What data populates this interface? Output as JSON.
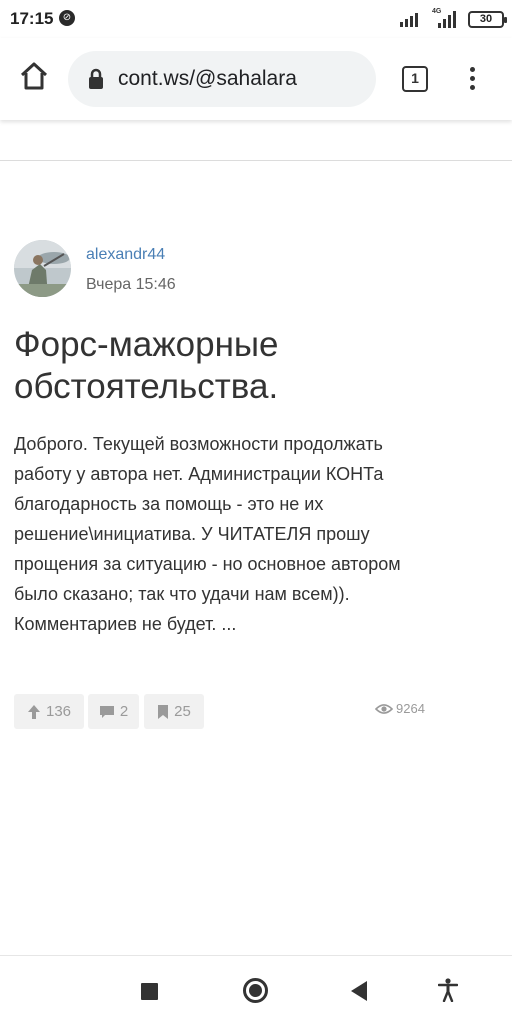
{
  "status_bar": {
    "time": "17:15",
    "network_label": "4G",
    "battery_level": "30"
  },
  "browser": {
    "url": "cont.ws/@sahalara",
    "tab_count": "1"
  },
  "post": {
    "author": "alexandr44",
    "time": "Вчера 15:46",
    "title": "Форс-мажорные обстоятельства.",
    "body": "Доброго. Текущей возможности продолжать работу у автора нет. Администрации КОНТа благодарность за помощь - это не их решение\\инициатива. У ЧИТАТЕЛЯ прошу прощения за ситуацию - но основное автором было сказано; так что удачи нам всем)). Комментариев не будет.  ..."
  },
  "stats": {
    "upvotes": "136",
    "comments": "2",
    "bookmarks": "25",
    "views": "9264"
  },
  "icons": {
    "home": "home-icon",
    "lock": "lock-icon",
    "menu": "more-vert-icon",
    "upvote": "arrow-up-icon",
    "comment": "comment-icon",
    "bookmark": "bookmark-icon",
    "views": "eye-icon"
  },
  "colors": {
    "author_link": "#4a7fb5",
    "stat_bg": "#f1f1f1",
    "stat_text": "#9a9a9a"
  }
}
